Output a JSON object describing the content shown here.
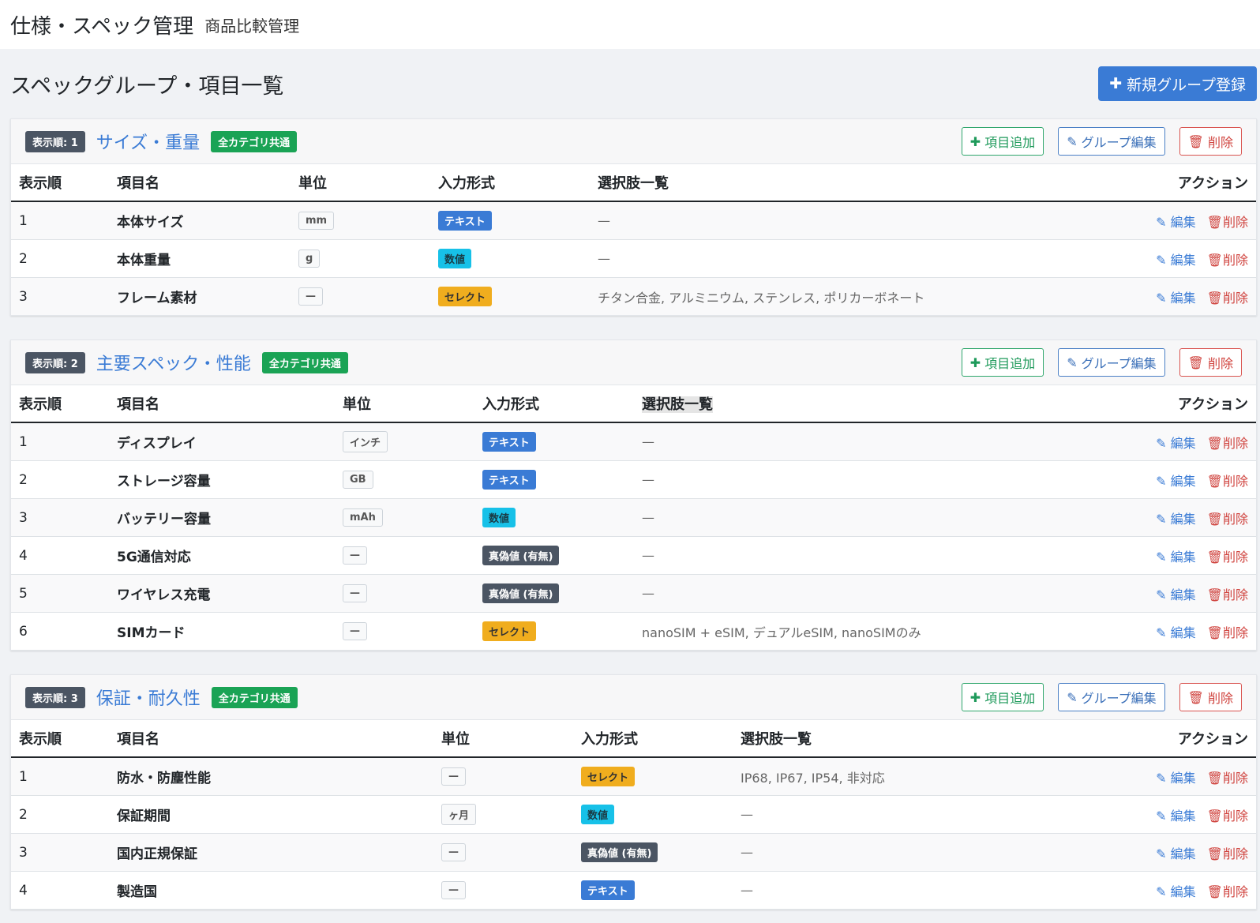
{
  "header": {
    "title": "仕様・スペック管理",
    "subtitle": "商品比較管理"
  },
  "page": {
    "heading": "スペックグループ・項目一覧",
    "new_group_label": "新規グループ登録"
  },
  "columns": {
    "order": "表示順",
    "name": "項目名",
    "unit": "単位",
    "type": "入力形式",
    "options": "選択肢一覧",
    "action": "アクション"
  },
  "actions": {
    "add_item": "項目追加",
    "edit_group": "グループ編集",
    "delete": "削除",
    "edit": "編集"
  },
  "groups": [
    {
      "order_badge": "表示順: 1",
      "title": "サイズ・重量",
      "scope": "全カテゴリ共通",
      "items": [
        {
          "order": "1",
          "name": "本体サイズ",
          "unit": "mm",
          "type": "テキスト",
          "type_kind": "text",
          "options": "—"
        },
        {
          "order": "2",
          "name": "本体重量",
          "unit": "g",
          "type": "数値",
          "type_kind": "num",
          "options": "—"
        },
        {
          "order": "3",
          "name": "フレーム素材",
          "unit": "—",
          "type": "セレクト",
          "type_kind": "sel",
          "options": "チタン合金, アルミニウム, ステンレス, ポリカーボネート"
        }
      ]
    },
    {
      "order_badge": "表示順: 2",
      "title": "主要スペック・性能",
      "scope": "全カテゴリ共通",
      "items": [
        {
          "order": "1",
          "name": "ディスプレイ",
          "unit": "インチ",
          "type": "テキスト",
          "type_kind": "text",
          "options": "—"
        },
        {
          "order": "2",
          "name": "ストレージ容量",
          "unit": "GB",
          "type": "テキスト",
          "type_kind": "text",
          "options": "—"
        },
        {
          "order": "3",
          "name": "バッテリー容量",
          "unit": "mAh",
          "type": "数値",
          "type_kind": "num",
          "options": "—"
        },
        {
          "order": "4",
          "name": "5G通信対応",
          "unit": "—",
          "type": "真偽値 (有無)",
          "type_kind": "bool",
          "options": "—"
        },
        {
          "order": "5",
          "name": "ワイヤレス充電",
          "unit": "—",
          "type": "真偽値 (有無)",
          "type_kind": "bool",
          "options": "—"
        },
        {
          "order": "6",
          "name": "SIMカード",
          "unit": "—",
          "type": "セレクト",
          "type_kind": "sel",
          "options": "nanoSIM + eSIM, デュアルeSIM, nanoSIMのみ"
        }
      ]
    },
    {
      "order_badge": "表示順: 3",
      "title": "保証・耐久性",
      "scope": "全カテゴリ共通",
      "items": [
        {
          "order": "1",
          "name": "防水・防塵性能",
          "unit": "—",
          "type": "セレクト",
          "type_kind": "sel",
          "options": "IP68, IP67, IP54, 非対応"
        },
        {
          "order": "2",
          "name": "保証期間",
          "unit": "ヶ月",
          "type": "数値",
          "type_kind": "num",
          "options": "—"
        },
        {
          "order": "3",
          "name": "国内正規保証",
          "unit": "—",
          "type": "真偽値 (有無)",
          "type_kind": "bool",
          "options": "—"
        },
        {
          "order": "4",
          "name": "製造国",
          "unit": "—",
          "type": "テキスト",
          "type_kind": "text",
          "options": "—"
        }
      ]
    }
  ]
}
